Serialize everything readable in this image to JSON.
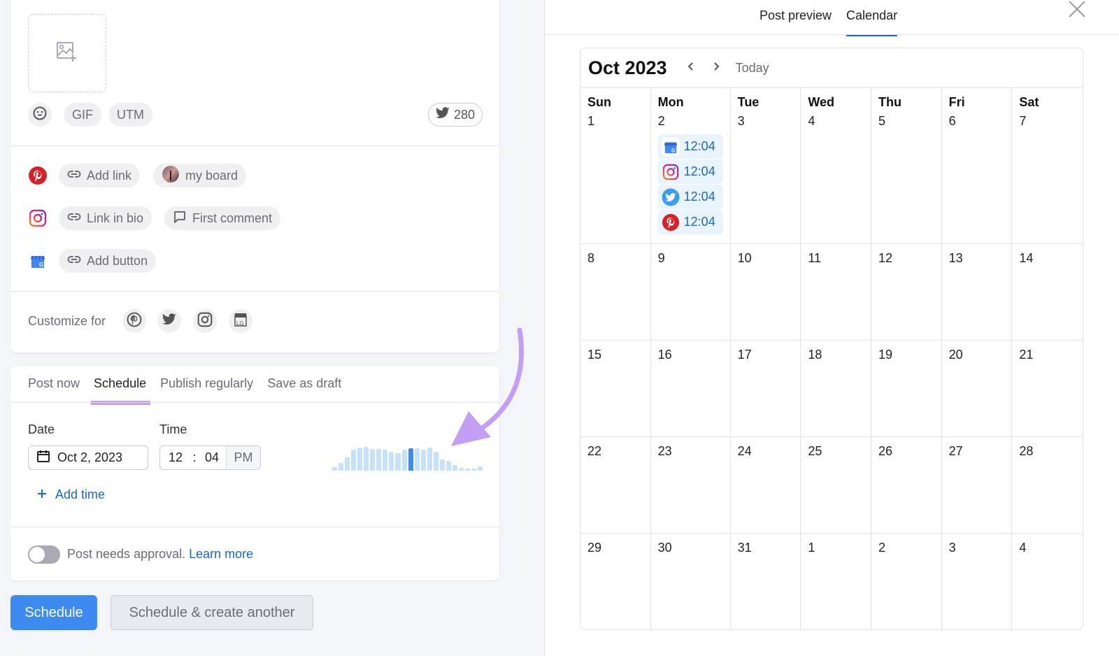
{
  "composer": {
    "media_placeholder_icon": "image-add-icon",
    "toolbar": {
      "emoji_icon": "emoji-icon",
      "gif_label": "GIF",
      "utm_label": "UTM",
      "char_count_network": "twitter",
      "char_count": "280"
    },
    "networks": [
      {
        "network": "pinterest",
        "actions": [
          {
            "icon": "link-icon",
            "label": "Add link"
          },
          {
            "icon": "board-avatar",
            "label": "my board"
          }
        ]
      },
      {
        "network": "instagram",
        "actions": [
          {
            "icon": "link-icon",
            "label": "Link in bio"
          },
          {
            "icon": "comment-icon",
            "label": "First comment"
          }
        ]
      },
      {
        "network": "google-business",
        "actions": [
          {
            "icon": "link-icon",
            "label": "Add button"
          }
        ]
      }
    ],
    "customize": {
      "label": "Customize for",
      "networks": [
        "pinterest",
        "twitter",
        "instagram",
        "google-business"
      ]
    }
  },
  "publish": {
    "tabs": [
      {
        "label": "Post now",
        "active": false
      },
      {
        "label": "Schedule",
        "active": true
      },
      {
        "label": "Publish regularly",
        "active": false
      },
      {
        "label": "Save as draft",
        "active": false
      }
    ],
    "date_label": "Date",
    "date_value": "Oct 2, 2023",
    "time_label": "Time",
    "time_hour": "12",
    "time_sep": ":",
    "time_minute": "04",
    "time_ampm": "PM",
    "add_time_label": "Add time",
    "activity_histogram": {
      "unit": "relative audience activity by hour (0-23)",
      "values": [
        0.12,
        0.28,
        0.5,
        0.78,
        0.88,
        0.9,
        0.82,
        0.82,
        0.8,
        0.72,
        0.66,
        0.78,
        0.85,
        0.85,
        0.78,
        0.88,
        0.72,
        0.42,
        0.38,
        0.2,
        0.1,
        0.05,
        0.08,
        0.15
      ],
      "highlighted_hour": 12
    },
    "approval_text": "Post needs approval.",
    "approval_link": "Learn more",
    "approval_enabled": false
  },
  "actions": {
    "primary": "Schedule",
    "secondary": "Schedule & create another"
  },
  "preview": {
    "tabs": [
      {
        "label": "Post preview",
        "active": false
      },
      {
        "label": "Calendar",
        "active": true
      }
    ],
    "close_icon": "close-icon"
  },
  "calendar": {
    "title": "Oct 2023",
    "today_label": "Today",
    "weekdays": [
      "Sun",
      "Mon",
      "Tue",
      "Wed",
      "Thu",
      "Fri",
      "Sat"
    ],
    "weeks": [
      [
        "1",
        "2",
        "3",
        "4",
        "5",
        "6",
        "7"
      ],
      [
        "8",
        "9",
        "10",
        "11",
        "12",
        "13",
        "14"
      ],
      [
        "15",
        "16",
        "17",
        "18",
        "19",
        "20",
        "21"
      ],
      [
        "22",
        "23",
        "24",
        "25",
        "26",
        "27",
        "28"
      ],
      [
        "29",
        "30",
        "31",
        "1",
        "2",
        "3",
        "4"
      ]
    ],
    "events": {
      "2": [
        {
          "network": "google-business",
          "time": "12:04"
        },
        {
          "network": "instagram",
          "time": "12:04"
        },
        {
          "network": "twitter",
          "time": "12:04"
        },
        {
          "network": "pinterest",
          "time": "12:04"
        }
      ]
    }
  },
  "colors": {
    "primary": "#3d8bf0",
    "link": "#1a66c9",
    "annotation": "#c39ef5",
    "pinterest": "#d3222a",
    "twitter": "#3a9df2",
    "histogram_bar": "#c6e1fb",
    "histogram_current": "#3d8bf0"
  }
}
